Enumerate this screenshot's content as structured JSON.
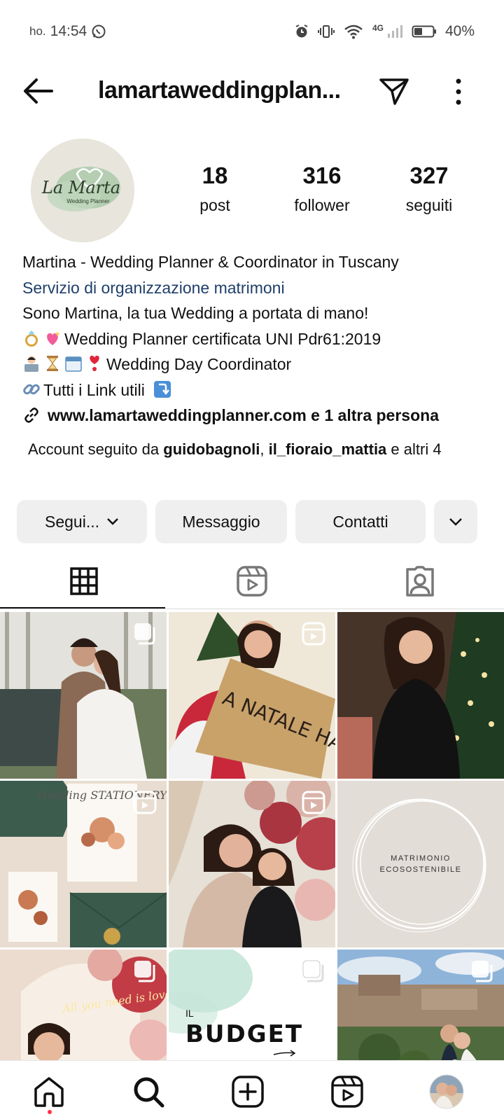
{
  "status_bar": {
    "carrier": "ho.",
    "time": "14:54",
    "network": "4G",
    "battery": "40%"
  },
  "header": {
    "username": "lamartaweddingplan..."
  },
  "profile": {
    "avatar_logo_text": "La Marta",
    "avatar_logo_subtext": "Wedding Planner",
    "stats": [
      {
        "value": "18",
        "label": "post"
      },
      {
        "value": "316",
        "label": "follower"
      },
      {
        "value": "327",
        "label": "seguiti"
      }
    ],
    "name": "Martina - Wedding Planner & Coordinator in Tuscany",
    "category": "Servizio di organizzazione matrimoni",
    "bio_lines": [
      "Sono Martina, la tua Wedding a portata di mano!",
      "Wedding Planner certificata UNI Pdr61:2019",
      "Wedding Day Coordinator",
      "Tutti i Link utili"
    ],
    "link_text": "www.lamartaweddingplanner.com e 1 altra persona",
    "followed_by_prefix": "Account seguito da ",
    "followed_by_user1": "guidobagnoli",
    "followed_by_sep": ", ",
    "followed_by_user2": "il_fioraio_mattia",
    "followed_by_suffix": " e altri 4"
  },
  "buttons": {
    "follow": "Segui...",
    "message": "Messaggio",
    "contacts": "Contatti"
  },
  "tabs": [
    {
      "name": "grid-icon",
      "active": true
    },
    {
      "name": "reels-icon",
      "active": false
    },
    {
      "name": "tagged-icon",
      "active": false
    }
  ],
  "grid_posts": [
    {
      "type": "carousel",
      "description": "couple-photo"
    },
    {
      "type": "reel",
      "text": "A NATALE HAI DETOS"
    },
    {
      "type": "photo",
      "description": "christmas-portrait"
    },
    {
      "type": "reel",
      "text": "Wedding STATIONERY"
    },
    {
      "type": "reel",
      "description": "two-women"
    },
    {
      "type": "photo",
      "text": "MATRIMONIO ECOSOSTENIBILE"
    },
    {
      "type": "carousel",
      "text": "All you need is love"
    },
    {
      "type": "carousel",
      "text_small": "IL",
      "text": "BUDGET"
    },
    {
      "type": "carousel",
      "description": "village-couple"
    }
  ],
  "nav": [
    "home-icon",
    "search-icon",
    "create-icon",
    "reels-icon",
    "profile-avatar"
  ],
  "colors": {
    "accent": "#1f3f6b",
    "button_bg": "#efefef",
    "notification": "#ff3040"
  }
}
